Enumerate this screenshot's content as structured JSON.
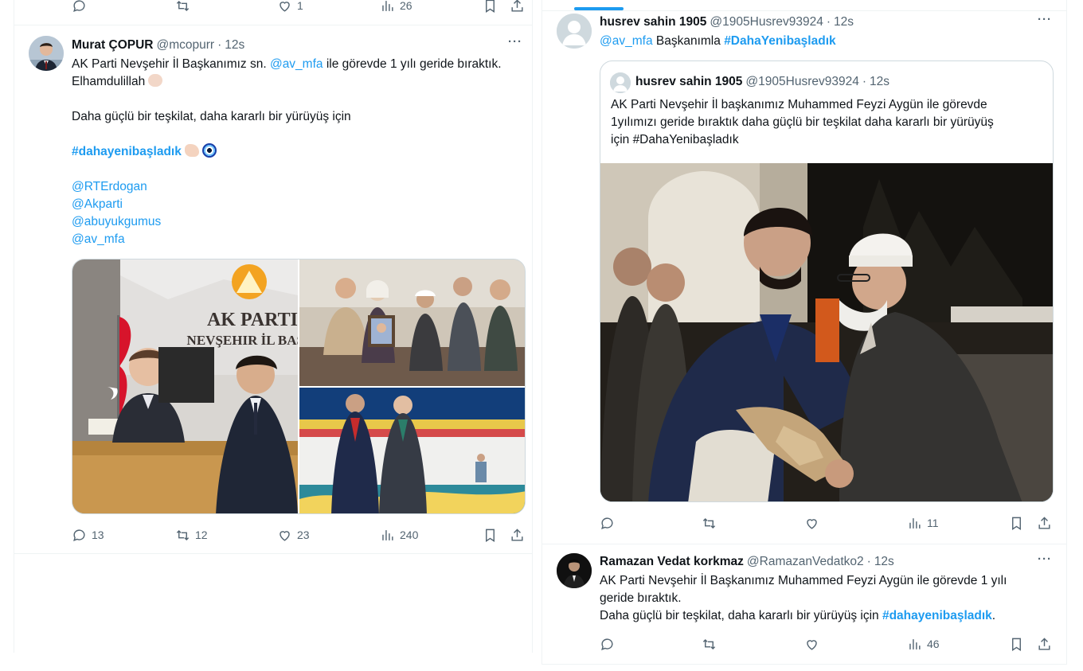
{
  "left_column": {
    "prev_tweet_actions": {
      "replies": "",
      "retweets": "",
      "likes": "1",
      "views": "26"
    },
    "tweet": {
      "name": "Murat ÇOPUR",
      "handle": "@mcopurr",
      "time": "12s",
      "text": {
        "line1_prefix": "AK Parti Nevşehir İl Başkanımız sn.",
        "line1_mention": "@av_mfa",
        "line1_suffix": "ile görevde 1 yılı geride bıraktık.",
        "line2": "Elhamdulillah",
        "line3": "Daha güçlü bir teşkilat, daha kararlı bir yürüyüş için",
        "hashtag": "#dahayenibaşladık",
        "mentions": [
          "@RTErdogan",
          "@Akparti",
          "@abuyukgumus",
          "@av_mfa"
        ]
      },
      "photo_sign_text": [
        "AK PARTI",
        "NEVŞEHIR İL BAŞKA"
      ],
      "actions": {
        "replies": "13",
        "retweets": "12",
        "likes": "23",
        "views": "240"
      }
    }
  },
  "right_column": {
    "tweet1": {
      "name": "husrev sahin 1905",
      "handle": "@1905Husrev93924",
      "time": "12s",
      "mention": "@av_mfa",
      "text_mid": "Başkanımla",
      "hashtag": "#DahaYenibaşladık",
      "quote": {
        "name": "husrev sahin 1905",
        "handle": "@1905Husrev93924",
        "time": "12s",
        "lines": [
          "AK Parti Nevşehir İl başkanımız Muhammed Feyzi Aygün ile görevde",
          "1yılımızı geride bıraktık daha güçlü bir teşkilat daha kararlı bir yürüyüş",
          "için #DahaYenibaşladık"
        ]
      },
      "actions": {
        "replies": "",
        "retweets": "",
        "likes": "",
        "views": "11"
      }
    },
    "tweet2": {
      "name": "Ramazan Vedat korkmaz",
      "handle": "@RamazanVedatko2",
      "time": "12s",
      "line1": "AK Parti Nevşehir İl Başkanımız Muhammed Feyzi Aygün ile görevde 1 yılı",
      "line2": "geride bıraktık.",
      "line3_prefix": "Daha güçlü bir teşkilat, daha kararlı bir yürüyüş için",
      "hashtag": "#dahayenibaşladık",
      "line3_suffix": ".",
      "actions": {
        "replies": "",
        "retweets": "",
        "likes": "",
        "views": "46"
      }
    }
  },
  "colors": {
    "accent": "#1d9bf0",
    "text": "#0f1419",
    "secondary": "#536471",
    "border": "#eff3f4"
  },
  "icons": [
    "reply-icon",
    "retweet-icon",
    "like-icon",
    "views-icon",
    "bookmark-icon",
    "share-icon",
    "more-icon"
  ]
}
